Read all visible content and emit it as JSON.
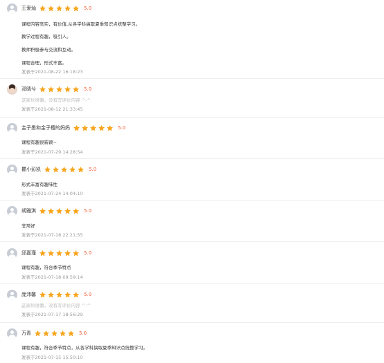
{
  "rating_color": "#f7a51d",
  "score_color": "#f25d33",
  "reviews": [
    {
      "name": "王爱灿",
      "score": "5.0",
      "stars": 5,
      "lines": [
        "课程内容充实，有价值,从各学科搞取夏季知识点统整学习。",
        "教学过程有趣，吸引人。",
        "教师积极参与交流和互动。",
        "课程合理，形式丰富。"
      ],
      "time": "发表于2021-08-22 16:18:23"
    },
    {
      "name": "邓晴兮",
      "score": "5.0",
      "stars": 5,
      "lines": [
        "这家伙很懒，没有写评价内容 ^-^"
      ],
      "time": "发表于2021-08-12 21:33:45"
    },
    {
      "name": "金子墨和金子樱的妈妈",
      "score": "5.0",
      "stars": 5,
      "lines": [
        "课程有趣很新颖~"
      ],
      "time": "发表于2021-07-29 14:28:54"
    },
    {
      "name": "瞿小彭凯",
      "score": "5.0",
      "stars": 5,
      "lines": [
        "形式丰富有趣味性"
      ],
      "time": "发表于2021-07-24 14:04:10"
    },
    {
      "name": "胡雅淇",
      "score": "5.0",
      "stars": 5,
      "lines": [
        "非常好"
      ],
      "time": "发表于2021-07-18 22:21:55"
    },
    {
      "name": "邱嘉瑾",
      "score": "5.0",
      "stars": 5,
      "lines": [
        "课程有趣，符合季节特点"
      ],
      "time": "发表于2021-07-18 09:59:14"
    },
    {
      "name": "庞沛馨",
      "score": "5.0",
      "stars": 5,
      "lines": [
        "这家伙很懒，没有写评价内容 ^-^"
      ],
      "time": "发表于2021-07-17 18:56:29"
    },
    {
      "name": "万青",
      "score": "5.0",
      "stars": 5,
      "lines": [
        "课程有趣，符合季节特点，从各学科搞取夏季知识点统整学习。"
      ],
      "time": "发表于2021-07-15 15:50:10"
    }
  ]
}
